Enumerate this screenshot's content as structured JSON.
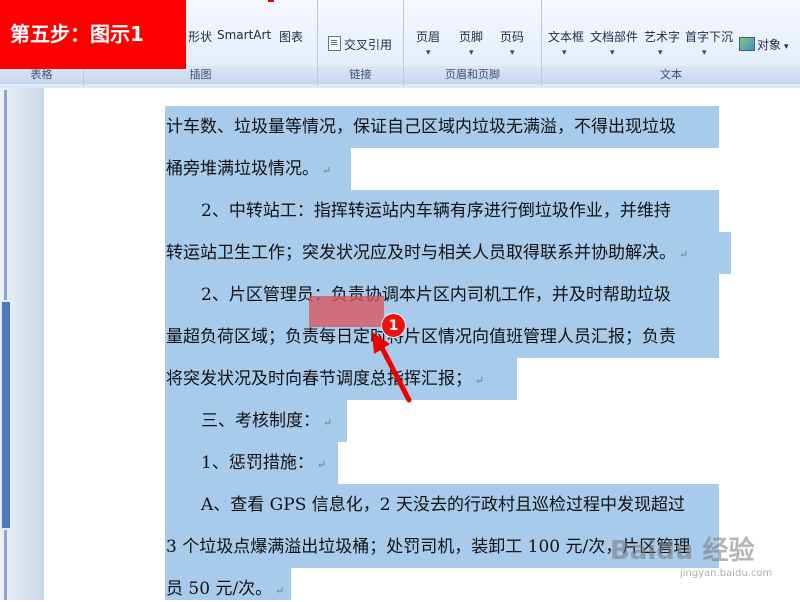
{
  "step_banner": "第五步：图示1",
  "ribbon": {
    "top_items": {
      "shapes_partial": "形状",
      "smartart": "SmartArt",
      "chart": "图表",
      "cross_ref": "交叉引用",
      "header": "页眉",
      "footer": "页脚",
      "page_number": "页码",
      "textbox": "文本框",
      "doc_parts": "文档部件",
      "wordart": "艺术字",
      "dropcap": "首字下沉",
      "object": "对象"
    },
    "groups": {
      "table": "表格",
      "illustrations": "插图",
      "links": "链接",
      "header_footer": "页眉和页脚",
      "text": "文本"
    }
  },
  "document": {
    "lines": [
      "计车数、垃圾量等情况，保证自己区域内垃圾无满溢，不得出现垃圾",
      "桶旁堆满垃圾情况。",
      "2、中转站工：指挥转运站内车辆有序进行倒垃圾作业，并维持",
      "转运站卫生工作；突发状况应及时与相关人员取得联系并协助解决。",
      "2、片区管理员：负责协调本片区内司机工作，并及时帮助垃圾",
      "量超负荷区域；负责每日定时将片区情况向值班管理人员汇报；负责",
      "将突发状况及时向春节调度总指挥汇报；",
      "三、考核制度：",
      "1、惩罚措施：",
      "A、查看 GPS 信息化，2 天没去的行政村且巡检过程中发现超过",
      "3 个垃圾点爆满溢出垃圾桶；处罚司机，装卸工 100 元/次，片区管理",
      "员 50 元/次。"
    ],
    "paragraph_mark": "↵"
  },
  "annotation": {
    "number": "1"
  },
  "watermark": {
    "brand": "Baidu 经验",
    "url": "jingyan.baidu.com"
  }
}
